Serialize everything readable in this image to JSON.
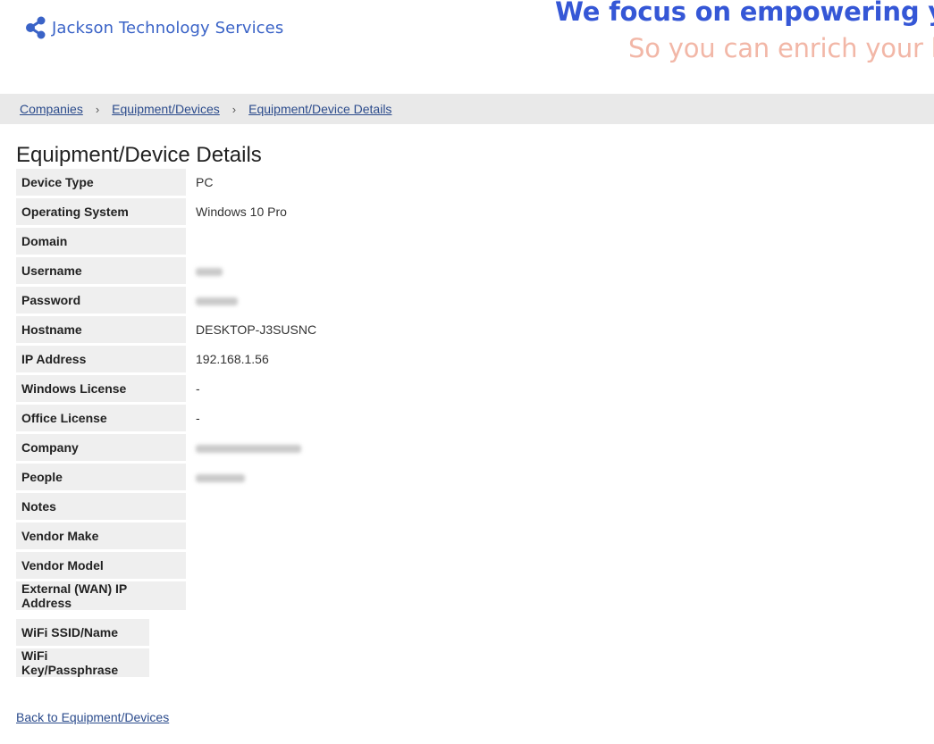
{
  "header": {
    "logo_text": "Jackson Technology Services",
    "logo_icon": "share-icon",
    "tagline": "We focus on empowering your te",
    "subtagline": "So you can enrich your busin",
    "tagline_color": "#3557d6",
    "subtagline_color": "#f2b7a7"
  },
  "breadcrumb": {
    "items": [
      "Companies",
      "Equipment/Devices",
      "Equipment/Device Details"
    ]
  },
  "page": {
    "title": "Equipment/Device Details",
    "back_link": "Back to Equipment/Devices"
  },
  "details": {
    "device_type": {
      "label": "Device Type",
      "value": "PC"
    },
    "operating_system": {
      "label": "Operating System",
      "value": "Windows 10 Pro"
    },
    "domain": {
      "label": "Domain",
      "value": ""
    },
    "username": {
      "label": "Username",
      "value": ""
    },
    "password": {
      "label": "Password",
      "value": ""
    },
    "hostname": {
      "label": "Hostname",
      "value": "DESKTOP-J3SUSNC"
    },
    "ip_address": {
      "label": "IP Address",
      "value": "192.168.1.56"
    },
    "windows_license": {
      "label": "Windows License",
      "value": "-"
    },
    "office_license": {
      "label": "Office License",
      "value": "-"
    },
    "company": {
      "label": "Company",
      "value": ""
    },
    "people": {
      "label": "People",
      "value": ""
    },
    "notes": {
      "label": "Notes",
      "value": ""
    },
    "vendor_make": {
      "label": "Vendor Make",
      "value": ""
    },
    "vendor_model": {
      "label": "Vendor Model",
      "value": ""
    },
    "external_ip": {
      "label": "External (WAN) IP Address",
      "value": ""
    }
  },
  "wifi": {
    "ssid": {
      "label": "WiFi SSID/Name"
    },
    "key": {
      "label": "WiFi Key/Passphrase"
    }
  }
}
